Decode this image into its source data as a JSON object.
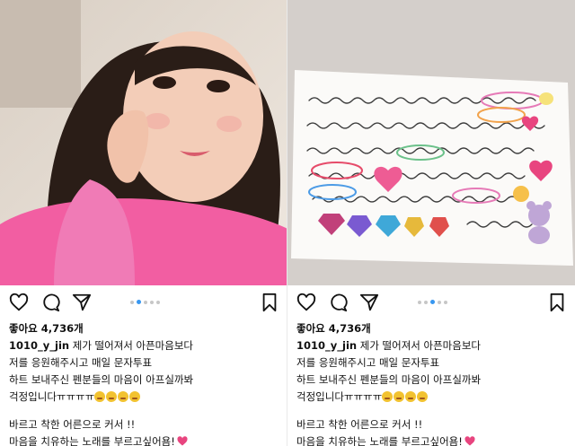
{
  "posts": [
    {
      "likes": "좋아요 4,736개",
      "username": "1010_y_jin",
      "caption": [
        "제가 떨어져서 아픈마음보다",
        "저를 응원해주시고 매일 문자투표",
        "하트 보내주신 펜분들의 마음이 아프실까봐",
        "걱정입니다ㅠㅠㅠㅠ"
      ],
      "caption2": [
        "바르고 착한 어른으로 커서 !!",
        "마음을 치유하는 노래를 부르고싶어욤!"
      ],
      "carousel": {
        "count": 5,
        "active": 1
      }
    },
    {
      "likes": "좋아요 4,736개",
      "username": "1010_y_jin",
      "caption": [
        "제가 떨어져서 아픈마음보다",
        "저를 응원해주시고 매일 문자투표",
        "하트 보내주신 펜분들의 마음이 아프실까봐",
        "걱정입니다ㅠㅠㅠㅠ"
      ],
      "caption2": [
        "바르고 착한 어른으로 커서 !!",
        "마음을 치유하는 노래를 부르고싶어욤!"
      ],
      "carousel": {
        "count": 5,
        "active": 2
      }
    }
  ],
  "icons": [
    "heart-icon",
    "comment-icon",
    "share-icon",
    "bookmark-icon",
    "emoji-crying-icon",
    "pink-heart-icon"
  ],
  "colors": {
    "accent_dot": "#3897f0",
    "inactive_dot": "#c7c7c7",
    "emoji": "#f2c230",
    "heart": "#e8457f"
  }
}
